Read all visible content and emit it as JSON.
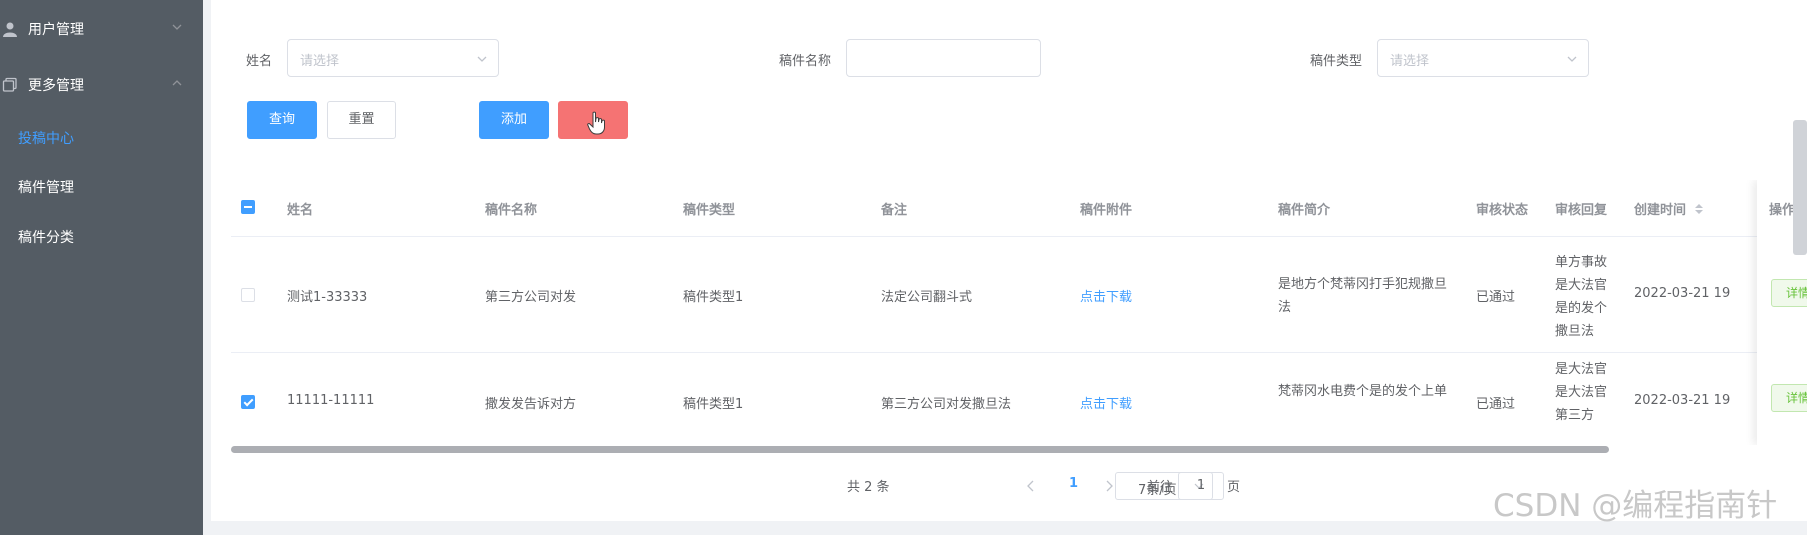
{
  "sidebar": {
    "user_menu": "用户管理",
    "more_menu": "更多管理",
    "items": [
      {
        "label": "投稿中心",
        "active": true
      },
      {
        "label": "稿件管理",
        "active": false
      },
      {
        "label": "稿件分类",
        "active": false
      }
    ]
  },
  "filters": {
    "name_label": "姓名",
    "name_placeholder": "请选择",
    "title_label": "稿件名称",
    "type_label": "稿件类型",
    "type_placeholder": "请选择"
  },
  "buttons": {
    "query": "查询",
    "reset": "重置",
    "add": "添加",
    "delete": ""
  },
  "table": {
    "columns": [
      "姓名",
      "稿件名称",
      "稿件类型",
      "备注",
      "稿件附件",
      "稿件简介",
      "审核状态",
      "审核回复",
      "创建时间",
      "操作"
    ],
    "rows": [
      {
        "checked": false,
        "name": "测试1-33333",
        "title": "第三方公司对发",
        "type": "稿件类型1",
        "remark": "法定公司翻斗式",
        "attachment": "点击下载",
        "intro": "是地方个梵蒂冈打手犯规撒旦法",
        "status": "已通过",
        "reply": "单方事故是大法官是的发个撒旦法",
        "created": "2022-03-21 19",
        "action": "详情"
      },
      {
        "checked": true,
        "name": "11111-11111",
        "title": "撒发发告诉对方",
        "type": "稿件类型1",
        "remark": "第三方公司对发撒旦法",
        "attachment": "点击下载",
        "intro": "梵蒂冈水电费个是的发个上单",
        "status": "已通过",
        "reply": "是大法官是大法官第三方",
        "created": "2022-03-21 19",
        "action": "详情"
      }
    ]
  },
  "pagination": {
    "total": "共 2 条",
    "page_size": "7条/页",
    "current_page": "1",
    "goto_label": "前往",
    "goto_value": "1",
    "page_suffix": "页"
  },
  "watermark": "CSDN @编程指南针",
  "colors": {
    "sidebar_bg": "#545c64",
    "primary": "#409eff",
    "danger": "#f56c6c",
    "success": "#67c23a"
  }
}
